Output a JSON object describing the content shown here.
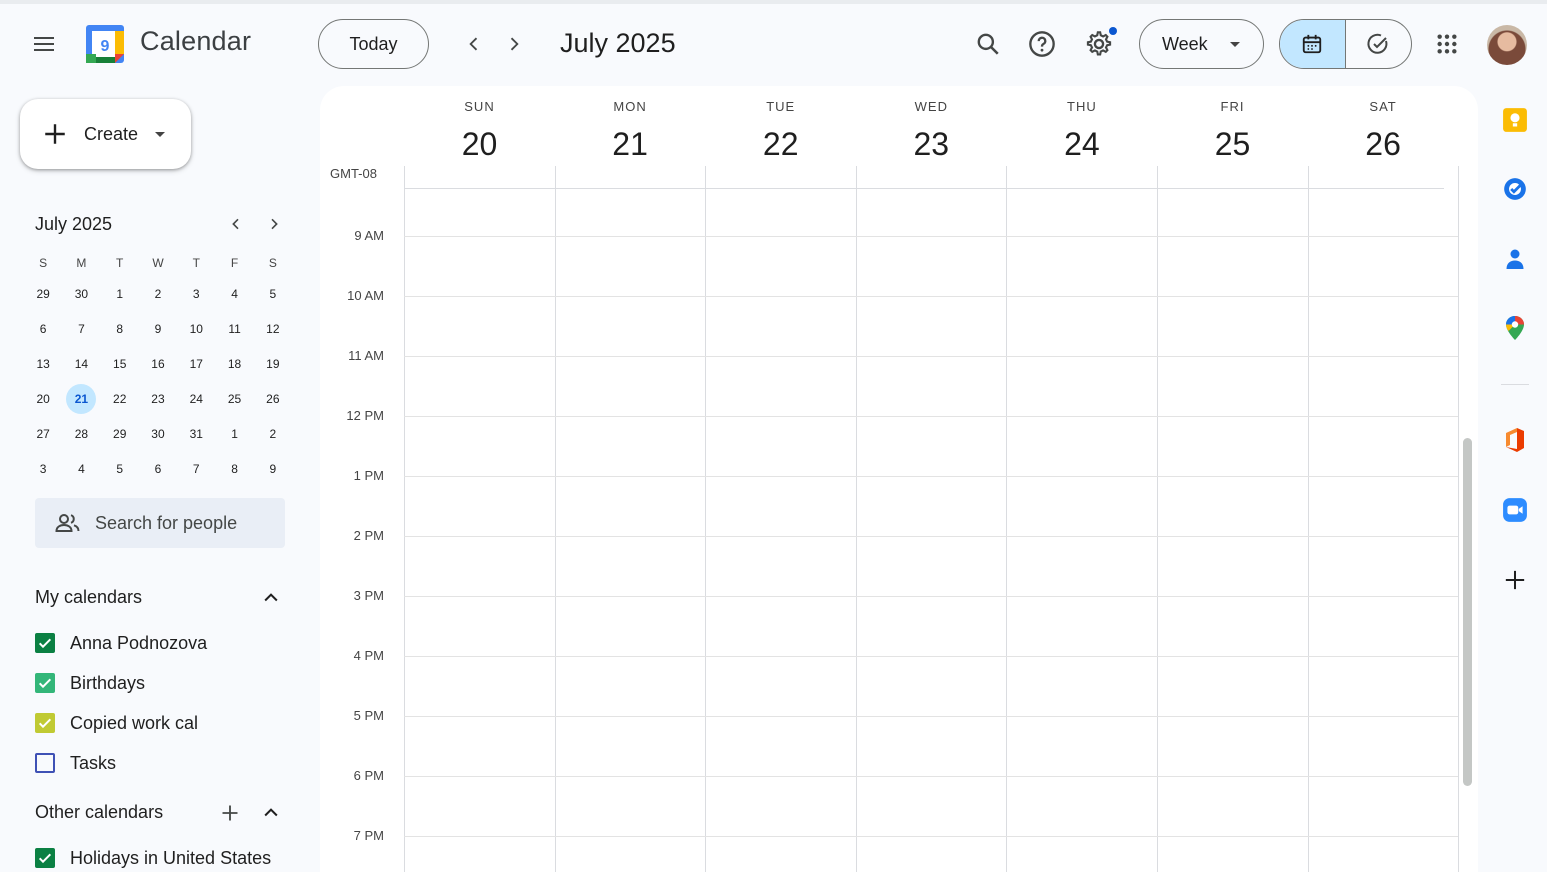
{
  "app": {
    "title": "Calendar",
    "logo_day": "9"
  },
  "header": {
    "today_label": "Today",
    "period_title": "July 2025",
    "view_label": "Week"
  },
  "sidebar": {
    "create_label": "Create",
    "mini_calendar": {
      "title": "July 2025",
      "weekdays": [
        "S",
        "M",
        "T",
        "W",
        "T",
        "F",
        "S"
      ],
      "weeks": [
        [
          "29",
          "30",
          "1",
          "2",
          "3",
          "4",
          "5"
        ],
        [
          "6",
          "7",
          "8",
          "9",
          "10",
          "11",
          "12"
        ],
        [
          "13",
          "14",
          "15",
          "16",
          "17",
          "18",
          "19"
        ],
        [
          "20",
          "21",
          "22",
          "23",
          "24",
          "25",
          "26"
        ],
        [
          "27",
          "28",
          "29",
          "30",
          "31",
          "1",
          "2"
        ],
        [
          "3",
          "4",
          "5",
          "6",
          "7",
          "8",
          "9"
        ]
      ],
      "selected_day": "21"
    },
    "people_search_placeholder": "Search for people",
    "my_calendars": {
      "title": "My calendars",
      "items": [
        {
          "name": "Anna Podnozova",
          "checked": true,
          "color": "#0b8043"
        },
        {
          "name": "Birthdays",
          "checked": true,
          "color": "#33b679"
        },
        {
          "name": "Copied work cal",
          "checked": true,
          "color": "#c0ca33"
        },
        {
          "name": "Tasks",
          "checked": false,
          "color": "#3f51b5"
        }
      ]
    },
    "other_calendars": {
      "title": "Other calendars",
      "items": [
        {
          "name": "Holidays in United States",
          "checked": true,
          "color": "#0b8043"
        }
      ]
    }
  },
  "week": {
    "timezone": "GMT-08",
    "days": [
      {
        "name": "SUN",
        "date": "20"
      },
      {
        "name": "MON",
        "date": "21"
      },
      {
        "name": "TUE",
        "date": "22"
      },
      {
        "name": "WED",
        "date": "23"
      },
      {
        "name": "THU",
        "date": "24"
      },
      {
        "name": "FRI",
        "date": "25"
      },
      {
        "name": "SAT",
        "date": "26"
      }
    ],
    "hours": [
      "9 AM",
      "10 AM",
      "11 AM",
      "12 PM",
      "1 PM",
      "2 PM",
      "3 PM",
      "4 PM",
      "5 PM",
      "6 PM",
      "7 PM"
    ]
  },
  "side_panel": {
    "icons": [
      "keep-icon",
      "tasks-icon",
      "contacts-icon",
      "maps-icon",
      "office-addon-icon",
      "zoom-addon-icon",
      "add-addon-icon"
    ]
  },
  "colors": {
    "accent": "#0b57d0",
    "selected_bg": "#c2e7ff"
  }
}
